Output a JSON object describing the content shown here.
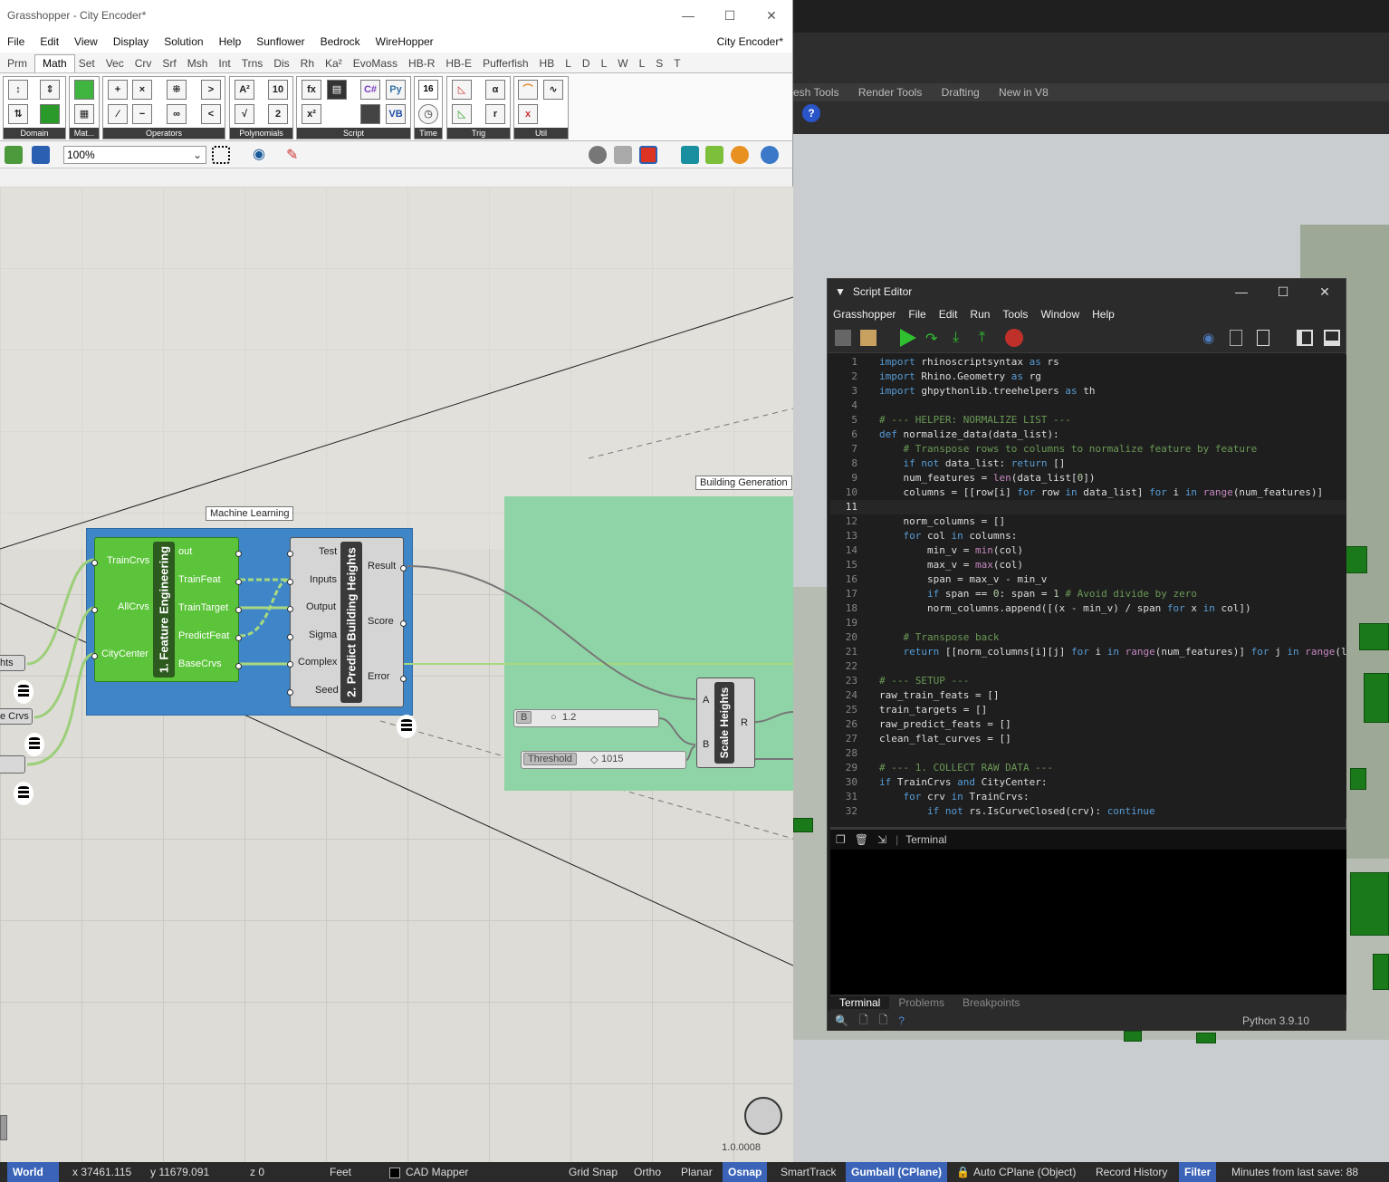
{
  "rhino": {
    "tabs": [
      "esh Tools",
      "Render Tools",
      "Drafting",
      "New in V8"
    ],
    "help_glyph": "?"
  },
  "grasshopper": {
    "title": "Grasshopper - City Encoder*",
    "document": "City Encoder*",
    "menu": [
      "File",
      "Edit",
      "View",
      "Display",
      "Solution",
      "Help",
      "Sunflower",
      "Bedrock",
      "WireHopper"
    ],
    "tabs": [
      "Prm",
      "Math",
      "Set",
      "Vec",
      "Crv",
      "Srf",
      "Msh",
      "Int",
      "Trns",
      "Dis",
      "Rh",
      "Ka²",
      "EvoMass",
      "HB-R",
      "HB-E",
      "Pufferfish",
      "HB",
      "L",
      "D",
      "L",
      "W",
      "L",
      "S",
      "T"
    ],
    "active_tab": "Math",
    "ribbon_groups": [
      "Domain",
      "Mat...",
      "Operators",
      "Polynomials",
      "Script",
      "Time",
      "Trig",
      "Util"
    ],
    "zoom": "100%",
    "version": "1.0.0008"
  },
  "canvas": {
    "group_ml": "Machine Learning",
    "group_bg": "Building Generation",
    "feature_engineering": {
      "title": "1. Feature Engineering",
      "inputs": [
        "TrainCrvs",
        "AllCrvs",
        "CityCenter"
      ],
      "outputs": [
        "out",
        "TrainFeat",
        "TrainTarget",
        "PredictFeat",
        "BaseCrvs"
      ]
    },
    "predict_heights": {
      "title": "2. Predict Building Heights",
      "inputs": [
        "Test",
        "Inputs",
        "Output",
        "Sigma",
        "Complex",
        "Seed"
      ],
      "outputs": [
        "Result",
        "Score",
        "Error"
      ]
    },
    "scale_heights": {
      "title": "Scale Heights",
      "inputs": [
        "A",
        "B"
      ],
      "outputs": [
        "R"
      ]
    },
    "slider_b": {
      "label": "B",
      "value": "1.2"
    },
    "slider_threshold": {
      "label": "Threshold",
      "value": "1015"
    },
    "stubs": [
      "hts",
      "e Crvs"
    ]
  },
  "script_editor": {
    "title": "Script Editor",
    "menu": [
      "Grasshopper",
      "File",
      "Edit",
      "Run",
      "Tools",
      "Window",
      "Help"
    ],
    "current_line": 11,
    "terminal_label": "Terminal",
    "bottom_tabs": [
      "Terminal",
      "Problems",
      "Breakpoints"
    ],
    "python_version": "Python 3.9.10",
    "code": [
      "import rhinoscriptsyntax as rs",
      "import Rhino.Geometry as rg",
      "import ghpythonlib.treehelpers as th",
      "",
      "# --- HELPER: NORMALIZE LIST ---",
      "def normalize_data(data_list):",
      "    # Transpose rows to columns to normalize feature by feature",
      "    if not data_list: return []",
      "    num_features = len(data_list[0])",
      "    columns = [[row[i] for row in data_list] for i in range(num_features)]",
      "",
      "    norm_columns = []",
      "    for col in columns:",
      "        min_v = min(col)",
      "        max_v = max(col)",
      "        span = max_v - min_v",
      "        if span == 0: span = 1 # Avoid divide by zero",
      "        norm_columns.append([(x - min_v) / span for x in col])",
      "",
      "    # Transpose back",
      "    return [[norm_columns[i][j] for i in range(num_features)] for j in range(l",
      "",
      "# --- SETUP ---",
      "raw_train_feats = []",
      "train_targets = []",
      "raw_predict_feats = []",
      "clean_flat_curves = []",
      "",
      "# --- 1. COLLECT RAW DATA ---",
      "if TrainCrvs and CityCenter:",
      "    for crv in TrainCrvs:",
      "        if not rs.IsCurveClosed(crv): continue"
    ]
  },
  "statusbar": {
    "world": "World",
    "x": "x 37461.115",
    "y": "y 11679.091",
    "z": "z 0",
    "units": "Feet",
    "cad_mapper": "CAD Mapper",
    "grid_snap": "Grid Snap",
    "ortho": "Ortho",
    "planar": "Planar",
    "osnap": "Osnap",
    "smarttrack": "SmartTrack",
    "gumball": "Gumball (CPlane)",
    "auto_cplane": "Auto CPlane (Object)",
    "record_history": "Record History",
    "filter": "Filter",
    "minutes": "Minutes from last save: 88"
  },
  "colors": {
    "ml_group": "#3f86c8",
    "bg_group": "#8fd4a6",
    "component_green": "#5cc43a",
    "status_highlight": "#3b64b8"
  }
}
